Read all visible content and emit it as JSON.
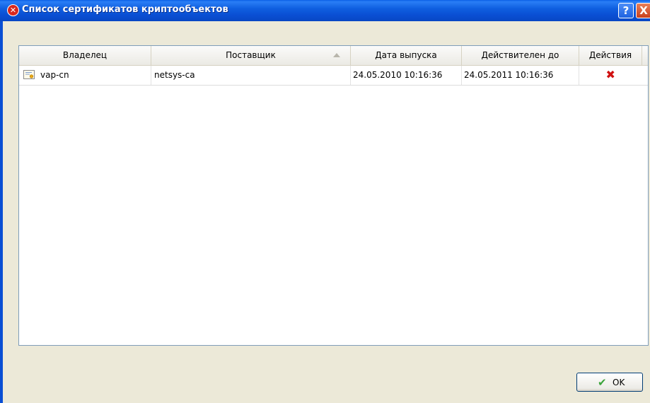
{
  "window": {
    "title": "Список сертификатов криптообъектов",
    "help_label": "?",
    "close_label": "X"
  },
  "table": {
    "columns": [
      "Владелец",
      "Поставщик",
      "Дата выпуска",
      "Действителен до",
      "Действия"
    ],
    "sort_column": "Поставщик",
    "rows": [
      {
        "owner": "vap-cn",
        "issuer": "netsys-ca",
        "issued": "24.05.2010 10:16:36",
        "valid_until": "24.05.2011 10:16:36",
        "action_icon": "delete-icon"
      }
    ]
  },
  "footer": {
    "ok_label": "OK",
    "ok_icon": "checkmark-icon"
  },
  "colors": {
    "titlebar": "#0a4fd4",
    "dialog_bg": "#ece9d8",
    "delete": "#d01010",
    "check": "#3aa33a"
  }
}
